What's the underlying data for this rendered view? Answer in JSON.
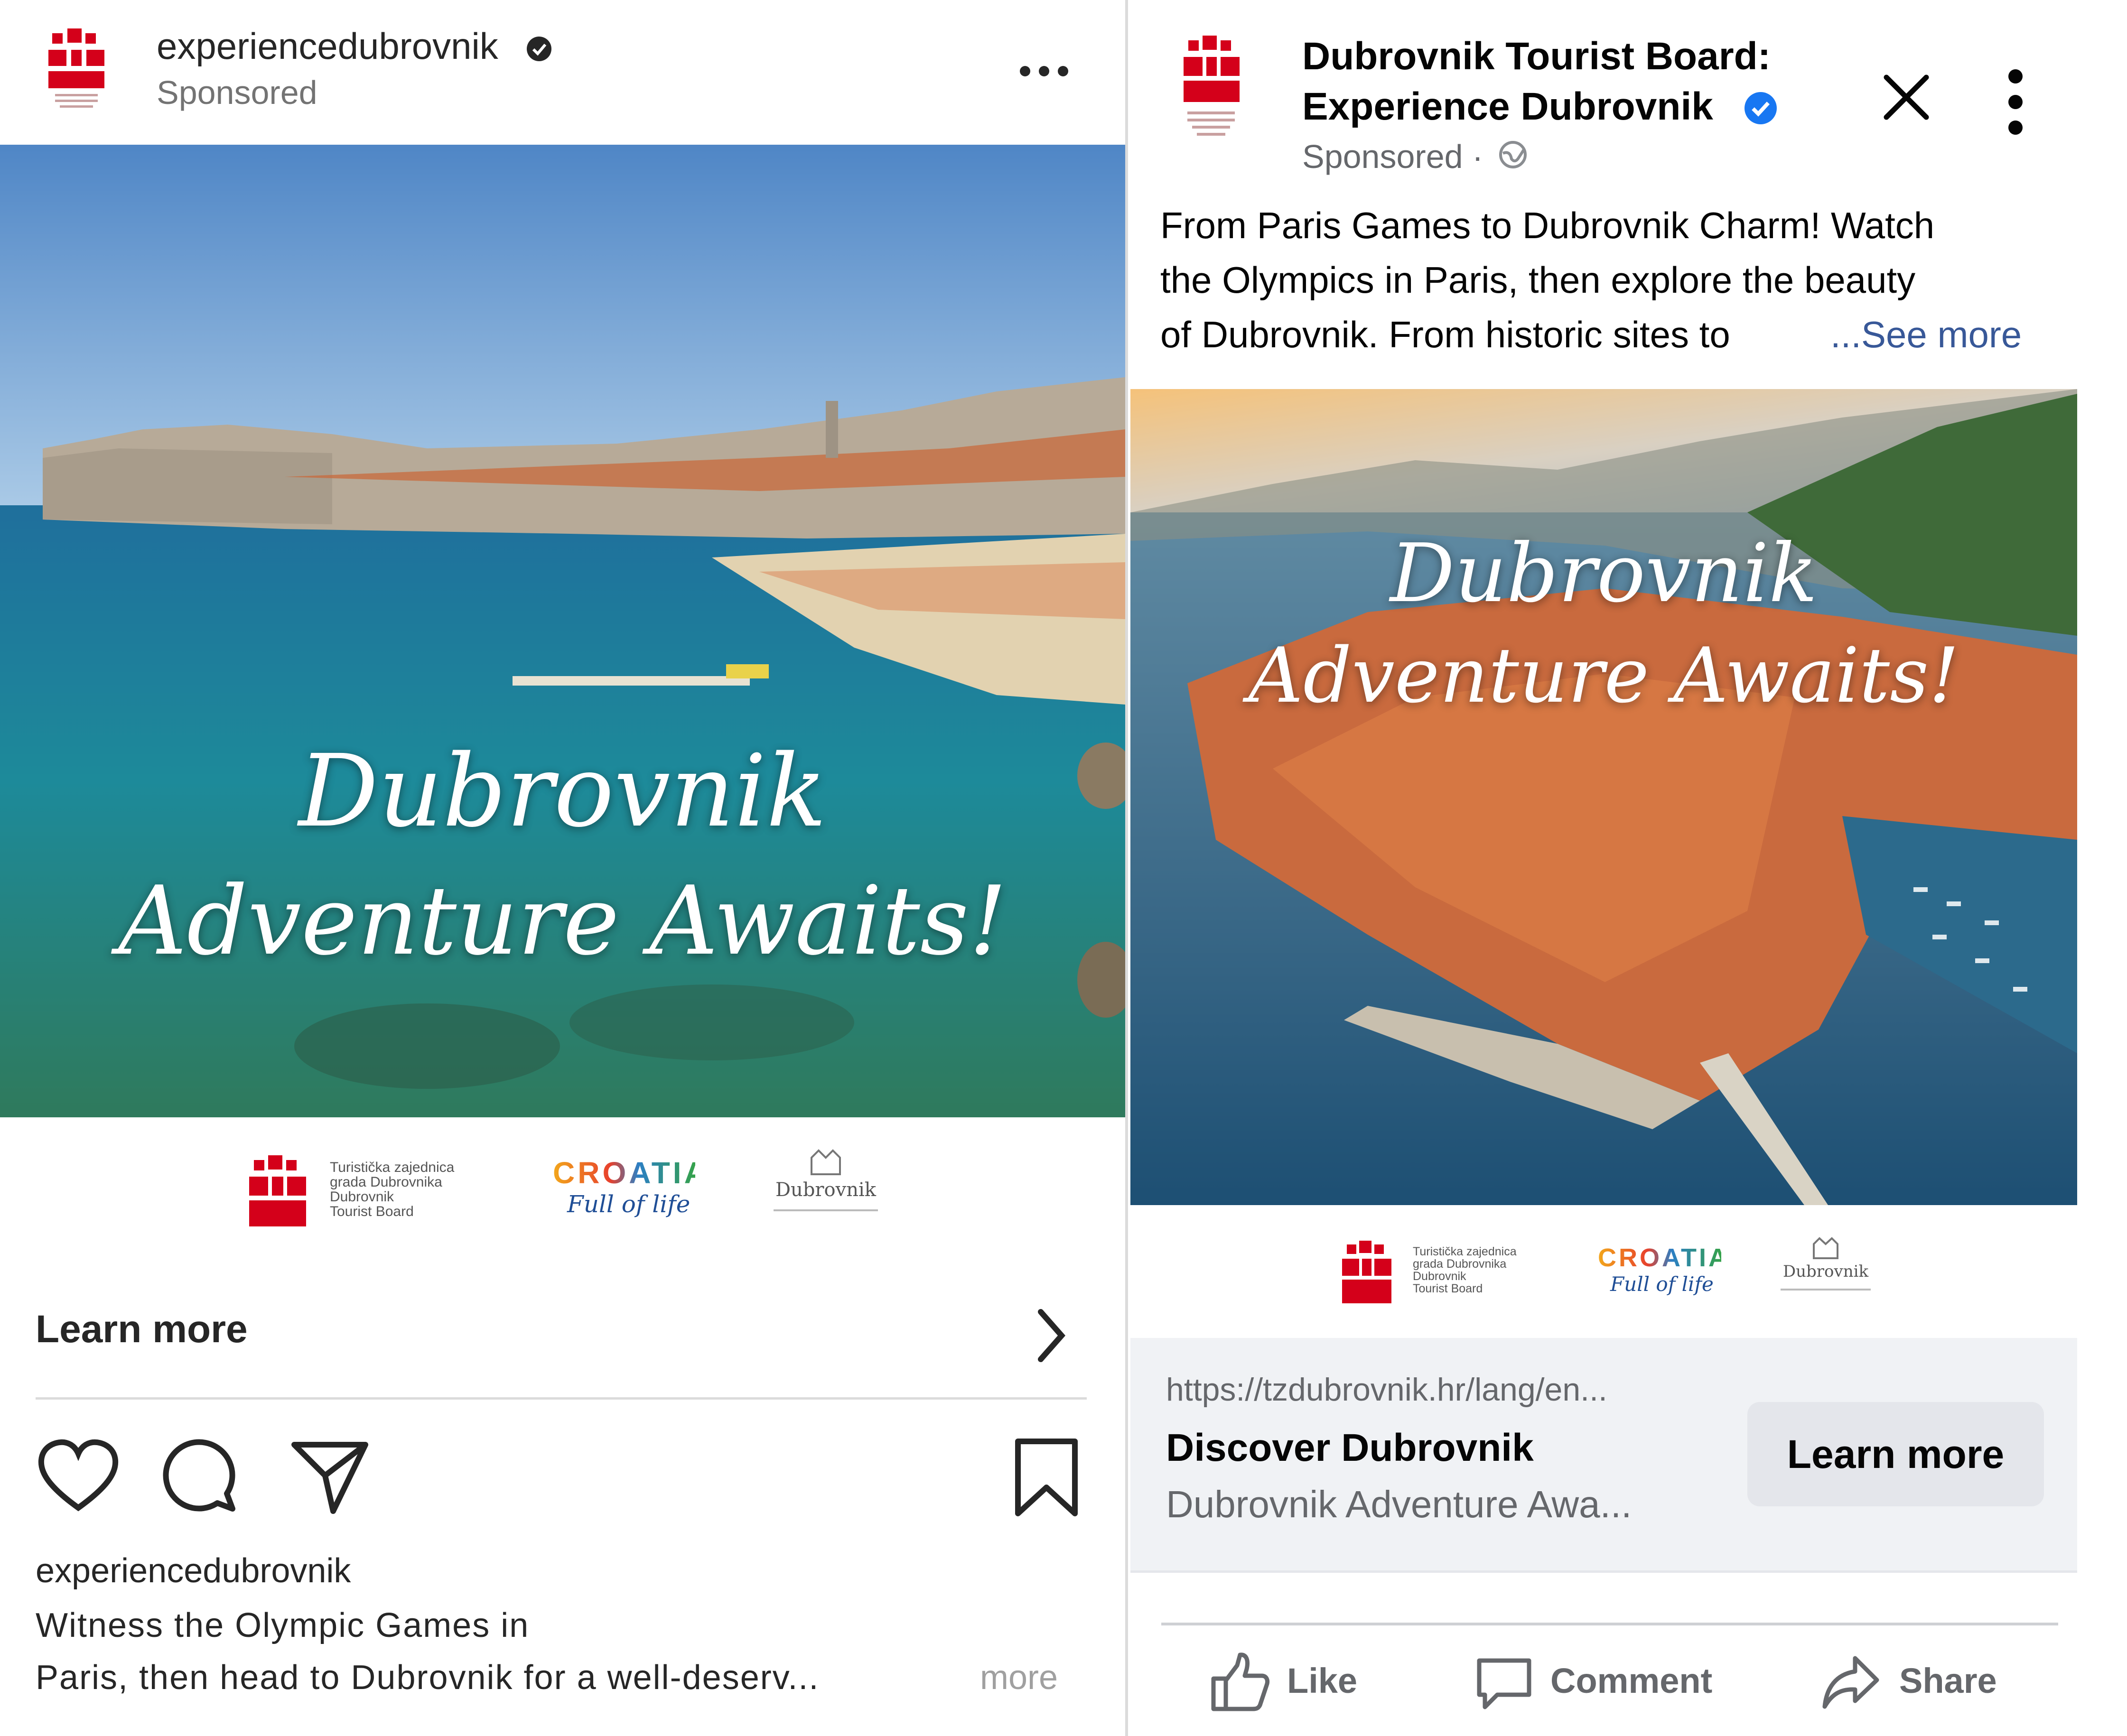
{
  "instagram": {
    "account_name": "experiencedubrovnik",
    "sponsored_label": "Sponsored",
    "more_icon": "more-horizontal-icon",
    "verified_icon": "verified-badge-icon",
    "hero_title_line1": "Dubrovnik",
    "hero_title_line2": "Adventure Awaits!",
    "footer_logos": {
      "tourist_board_lines": [
        "Turistička zajednica",
        "grada Dubrovnika",
        "Dubrovnik",
        "Tourist Board"
      ],
      "croatia_word": "CROATIA",
      "croatia_tagline": "Full of life",
      "city_word": "Dubrovnik"
    },
    "cta_label": "Learn more",
    "cta_icon": "chevron-right-icon",
    "actions": [
      "heart-icon",
      "comment-icon",
      "share-icon",
      "bookmark-icon"
    ],
    "caption_account": "experiencedubrovnik",
    "caption_line1": "Witness the Olympic Games in",
    "caption_line2": "Paris, then head to Dubrovnik for a well-deserv...",
    "caption_more": "more"
  },
  "facebook": {
    "page_name_line1": "Dubrovnik Tourist Board:",
    "page_name_line2": "Experience Dubrovnik",
    "sponsored_label": "Sponsored ·",
    "globe_icon": "globe-icon",
    "post_text_line1": "From Paris Games to Dubrovnik Charm! Watch",
    "post_text_line2": "the Olympics in Paris, then explore the beauty",
    "post_text_line3": "of Dubrovnik. From historic sites to",
    "see_more": "...See more",
    "hero_title_line1": "Dubrovnik",
    "hero_title_line2": "Adventure Awaits!",
    "footer_logos": {
      "tourist_board_lines": [
        "Turistička zajednica",
        "grada Dubrovnika",
        "Dubrovnik",
        "Tourist Board"
      ],
      "croatia_word": "CROATIA",
      "croatia_tagline": "Full of life",
      "city_word": "Dubrovnik"
    },
    "link_url": "https://tzdubrovnik.hr/lang/en...",
    "link_title": "Discover Dubrovnik",
    "link_description": "Dubrovnik Adventure Awa...",
    "cta_label": "Learn more",
    "actions": {
      "like": "Like",
      "comment": "Comment",
      "share": "Share"
    }
  },
  "colors": {
    "brand_red": "#d4001a",
    "fb_blue": "#1877f2",
    "link_blue": "#385898",
    "ig_gray": "#737373",
    "fb_gray": "#65676b",
    "cta_bg": "#e4e6eb",
    "link_bg": "#f0f2f5"
  }
}
